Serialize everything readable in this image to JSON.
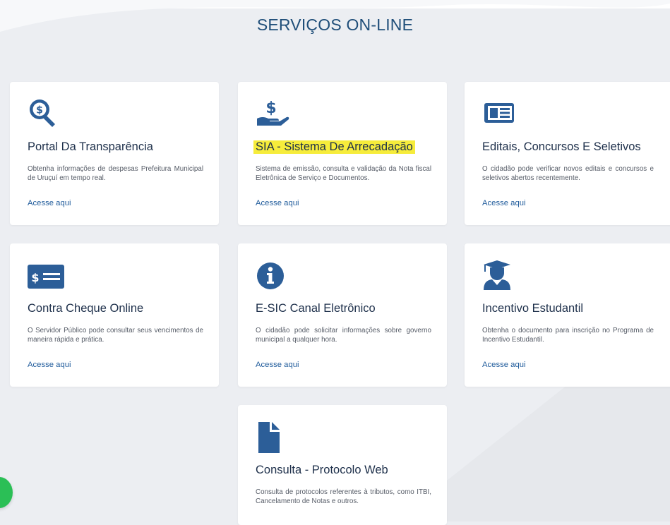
{
  "section": {
    "title": "SERVIÇOS ON-LINE"
  },
  "colors": {
    "accent": "#2c5e98",
    "title_text": "#1d2f4a",
    "link": "#1f5b9b",
    "highlight": "#f6ec3b",
    "background": "#eceef2",
    "chat_button": "#2bbf56"
  },
  "cards": [
    {
      "icon": "magnifier-dollar-icon",
      "title": "Portal Da Transparência",
      "description": "Obtenha informações de despesas Prefeitura Municipal de Uruçuí em tempo real.",
      "link": "Acesse aqui"
    },
    {
      "icon": "hand-dollar-icon",
      "title": "SIA - Sistema De Arrecadação",
      "highlighted": true,
      "description": "Sistema de emissão, consulta e validação da Nota fiscal Eletrônica de Serviço e Documentos.",
      "link": "Acesse aqui"
    },
    {
      "icon": "newspaper-icon",
      "title": "Editais, Concursos E Seletivos",
      "description": "O cidadão pode verificar novos editais e concursos e seletivos abertos recentemente.",
      "link": "Acesse aqui"
    },
    {
      "icon": "money-check-icon",
      "title": "Contra Cheque Online",
      "description": "O Servidor Público pode consultar seus vencimentos de maneira rápida e prática.",
      "link": "Acesse aqui"
    },
    {
      "icon": "info-circle-icon",
      "title": "E-SIC Canal Eletrônico",
      "description": "O cidadão pode solicitar informações sobre governo municipal a qualquer hora.",
      "link": "Acesse aqui"
    },
    {
      "icon": "graduate-icon",
      "title": "Incentivo Estudantil",
      "description": "Obtenha o documento para inscrição no Programa de Incentivo Estudantil.",
      "link": "Acesse aqui"
    },
    {
      "icon": "file-icon",
      "title": "Consulta - Protocolo Web",
      "description": "Consulta de protocolos referentes à tributos, como ITBI, Cancelamento de Notas e outros."
    }
  ],
  "chat": {
    "icon": "chat-icon"
  }
}
